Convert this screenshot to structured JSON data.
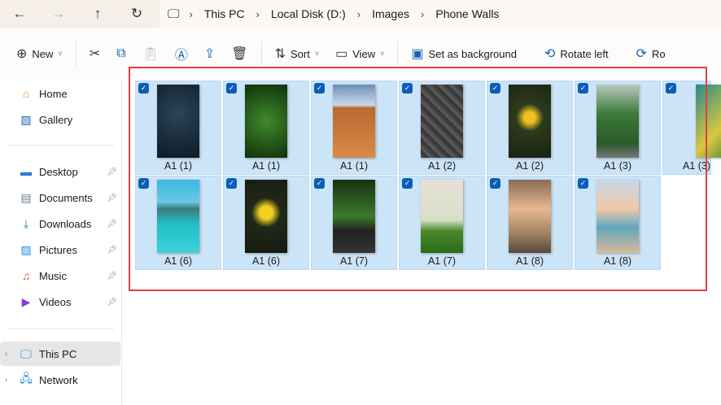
{
  "nav": {
    "back": "←",
    "forward": "→",
    "up": "↑",
    "refresh": "↻"
  },
  "breadcrumb": [
    "This PC",
    "Local Disk (D:)",
    "Images",
    "Phone Walls"
  ],
  "toolbar": {
    "new": "New",
    "sort": "Sort",
    "view": "View",
    "set_background": "Set as background",
    "rotate_left": "Rotate left",
    "rotate_right": "Ro"
  },
  "sidebar": [
    {
      "label": "Home",
      "icon": "home-icon"
    },
    {
      "label": "Gallery",
      "icon": "gallery-icon"
    },
    {
      "label": "Desktop",
      "icon": "desktop-icon",
      "pinned": true
    },
    {
      "label": "Documents",
      "icon": "documents-icon",
      "pinned": true
    },
    {
      "label": "Downloads",
      "icon": "downloads-icon",
      "pinned": true
    },
    {
      "label": "Pictures",
      "icon": "pictures-icon",
      "pinned": true
    },
    {
      "label": "Music",
      "icon": "music-icon",
      "pinned": true
    },
    {
      "label": "Videos",
      "icon": "videos-icon",
      "pinned": true
    },
    {
      "label": "This PC",
      "icon": "pc-icon",
      "selected": true
    },
    {
      "label": "Network",
      "icon": "network-icon"
    }
  ],
  "files": [
    {
      "name": "A1 (1)",
      "selected": true
    },
    {
      "name": "A1 (1)",
      "selected": true
    },
    {
      "name": "A1 (1)",
      "selected": true
    },
    {
      "name": "A1 (2)",
      "selected": true
    },
    {
      "name": "A1 (2)",
      "selected": true
    },
    {
      "name": "A1 (3)",
      "selected": true
    },
    {
      "name": "A1 (3)",
      "selected": true
    },
    {
      "name": "A1 (6)",
      "selected": true
    },
    {
      "name": "A1 (6)",
      "selected": true
    },
    {
      "name": "A1 (7)",
      "selected": true
    },
    {
      "name": "A1 (7)",
      "selected": true
    },
    {
      "name": "A1 (8)",
      "selected": true
    },
    {
      "name": "A1 (8)",
      "selected": true
    }
  ],
  "colors": {
    "selection": "#cce4f7",
    "checkbox": "#0a5fb4",
    "highlight_box": "#e0403c"
  }
}
